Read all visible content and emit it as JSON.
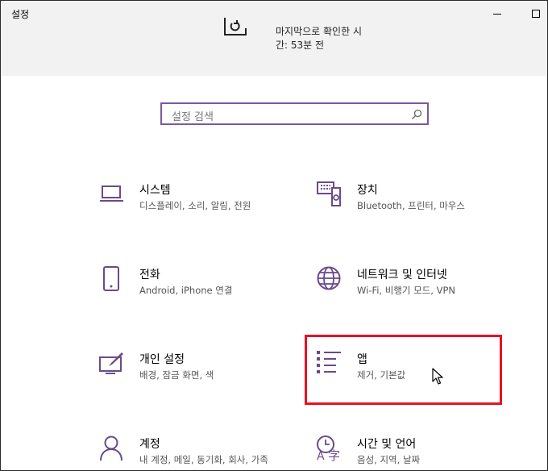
{
  "window": {
    "title": "설정"
  },
  "update": {
    "line1": "마지막으로 확인한 시",
    "line2": "간: 53분 전"
  },
  "search": {
    "placeholder": "설정 검색"
  },
  "categories": [
    {
      "name": "시스템",
      "desc": "디스플레이, 소리, 알림, 전원",
      "icon": "laptop-icon"
    },
    {
      "name": "장치",
      "desc": "Bluetooth, 프린터, 마우스",
      "icon": "devices-icon"
    },
    {
      "name": "전화",
      "desc": "Android, iPhone 연결",
      "icon": "phone-icon"
    },
    {
      "name": "네트워크 및 인터넷",
      "desc": "Wi-Fi, 비행기 모드, VPN",
      "icon": "globe-icon"
    },
    {
      "name": "개인 설정",
      "desc": "배경, 잠금 화면, 색",
      "icon": "personalization-icon"
    },
    {
      "name": "앱",
      "desc": "제거, 기본값",
      "icon": "apps-list-icon"
    },
    {
      "name": "계정",
      "desc": "내 계정, 메일, 동기화, 회사, 가족",
      "icon": "person-icon"
    },
    {
      "name": "시간 및 언어",
      "desc": "음성, 지역, 날짜",
      "icon": "time-language-icon"
    }
  ],
  "colors": {
    "accent": "#6b4a8b",
    "highlight": "#e81123",
    "banner": "#f2f2f2"
  }
}
